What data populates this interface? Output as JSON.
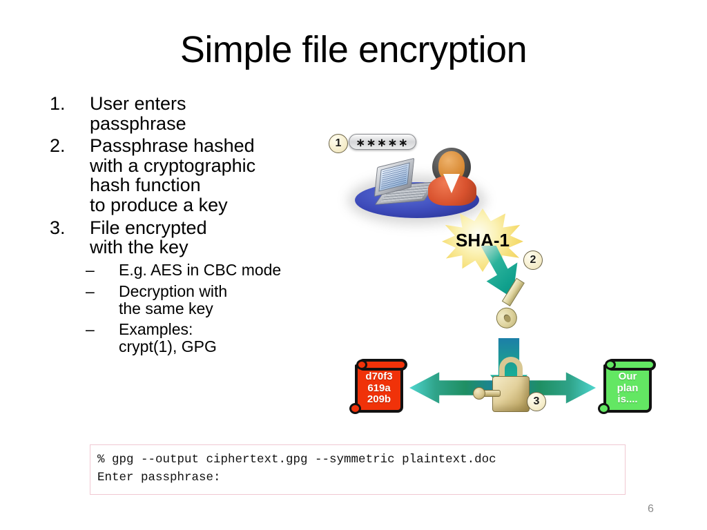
{
  "slide": {
    "title": "Simple file encryption",
    "page_number": "6"
  },
  "bullets": [
    {
      "marker": "1.",
      "text": "User enters\npassphrase"
    },
    {
      "marker": "2.",
      "text": "Passphrase hashed\nwith a cryptographic\nhash function\nto produce a key"
    },
    {
      "marker": "3.",
      "text": "File encrypted\nwith the key"
    }
  ],
  "sub_bullets": [
    {
      "marker": "–",
      "text": "E.g. AES in CBC mode"
    },
    {
      "marker": "–",
      "text": "Decryption with\nthe same key"
    },
    {
      "marker": "–",
      "text": "Examples:\ncrypt(1), GPG"
    }
  ],
  "diagram": {
    "step_badges": {
      "one": "1",
      "two": "2",
      "three": "3"
    },
    "password_field_value": "∗∗∗∗∗",
    "hash_label": "SHA-1",
    "ciphertext_scroll": {
      "line1": "d70f3",
      "line2": "619a",
      "line3": "209b",
      "color": "#f03209"
    },
    "plaintext_scroll": {
      "line1": "Our",
      "line2": "plan",
      "line3": "is....",
      "color": "#63e763"
    },
    "colors": {
      "badge_fill": "#f6eecd",
      "badge_border": "#6b6347",
      "burst_fill": "#f6df78",
      "arrow_teal": "#16b39b",
      "arrow_blue": "#1a7fa6",
      "key_gold": "#ddd29c",
      "table_blue": "#3c49b8"
    }
  },
  "command_box": {
    "line1": "% gpg --output ciphertext.gpg --symmetric plaintext.doc",
    "line2": "Enter passphrase:",
    "border_color": "#f0c8d2"
  }
}
